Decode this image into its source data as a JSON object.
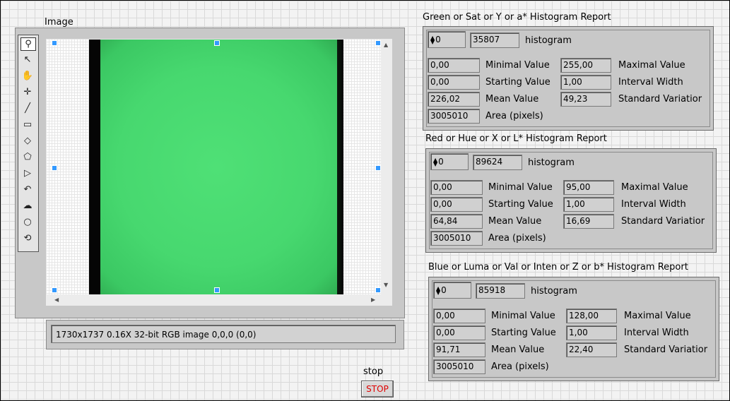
{
  "image_display": {
    "label": "Image",
    "status": "1730x1737 0.16X 32-bit RGB image 0,0,0    (0,0)"
  },
  "tools": [
    {
      "icon": "zoom-icon",
      "glyph": "⚲"
    },
    {
      "icon": "pointer-icon",
      "glyph": "↖"
    },
    {
      "icon": "pan-hand-icon",
      "glyph": "✋"
    },
    {
      "icon": "crosshair-icon",
      "glyph": "✛"
    },
    {
      "icon": "line-icon",
      "glyph": "╱"
    },
    {
      "icon": "rectangle-icon",
      "glyph": "▭"
    },
    {
      "icon": "rotated-rectangle-icon",
      "glyph": "◇"
    },
    {
      "icon": "polygon-icon",
      "glyph": "⬠"
    },
    {
      "icon": "annulus-icon",
      "glyph": "▷"
    },
    {
      "icon": "freehand-line-icon",
      "glyph": "↶"
    },
    {
      "icon": "freehand-region-icon",
      "glyph": "☁"
    },
    {
      "icon": "oval-icon",
      "glyph": "○"
    },
    {
      "icon": "broken-line-icon",
      "glyph": "⟲"
    }
  ],
  "reports": [
    {
      "title": "Green or Sat or Y or a* Histogram Report",
      "index": "0",
      "count": "35807",
      "histogram_label": "histogram",
      "min_value": "0,00",
      "min_label": "Minimal Value",
      "max_value": "255,00",
      "max_label": "Maximal Value",
      "start_value": "0,00",
      "start_label": "Starting Value",
      "interval_value": "1,00",
      "interval_label": "Interval Width",
      "mean_value": "226,02",
      "mean_label": "Mean Value",
      "std_value": "49,23",
      "std_label": "Standard Variatior",
      "area_value": "3005010",
      "area_label": "Area (pixels)"
    },
    {
      "title": "Red or Hue or X or L* Histogram Report",
      "index": "0",
      "count": "89624",
      "histogram_label": "histogram",
      "min_value": "0,00",
      "min_label": "Minimal Value",
      "max_value": "95,00",
      "max_label": "Maximal Value",
      "start_value": "0,00",
      "start_label": "Starting Value",
      "interval_value": "1,00",
      "interval_label": "Interval Width",
      "mean_value": "64,84",
      "mean_label": "Mean Value",
      "std_value": "16,69",
      "std_label": "Standard Variatior",
      "area_value": "3005010",
      "area_label": "Area (pixels)"
    },
    {
      "title": "Blue or Luma or Val or Inten or Z or b* Histogram Report",
      "index": "0",
      "count": "85918",
      "histogram_label": "histogram",
      "min_value": "0,00",
      "min_label": "Minimal Value",
      "max_value": "128,00",
      "max_label": "Maximal Value",
      "start_value": "0,00",
      "start_label": "Starting Value",
      "interval_value": "1,00",
      "interval_label": "Interval Width",
      "mean_value": "91,71",
      "mean_label": "Mean Value",
      "std_value": "22,40",
      "std_label": "Standard Variatior",
      "area_value": "3005010",
      "area_label": "Area (pixels)"
    }
  ],
  "stop": {
    "caption": "stop",
    "button_label": "STOP"
  },
  "colors": {
    "image_green": "#47d86f",
    "roi_handle": "#3399ff",
    "stop_text": "#e00000"
  }
}
